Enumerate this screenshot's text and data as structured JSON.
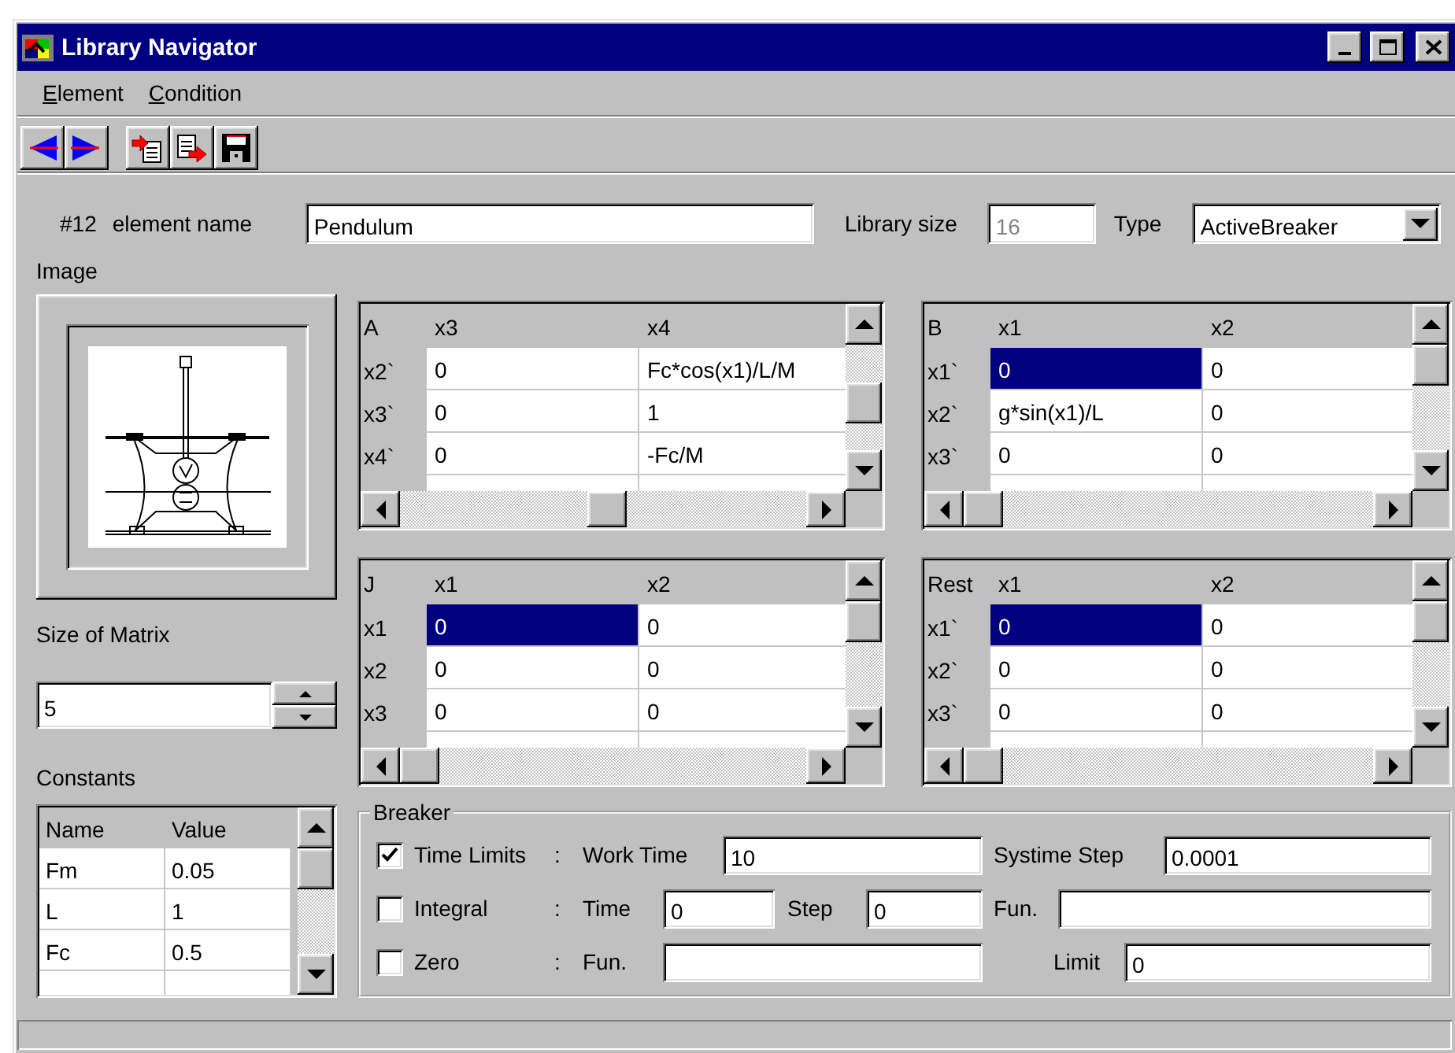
{
  "window": {
    "title": "Library Navigator"
  },
  "menu": [
    {
      "label": "Element"
    },
    {
      "label": "Condition"
    }
  ],
  "element": {
    "number": "#12",
    "label": "element name",
    "value": "Pendulum"
  },
  "library_size": {
    "label": "Library size",
    "value": "16",
    "disabled": true
  },
  "type": {
    "label": "Type",
    "value": "ActiveBreaker"
  },
  "image": {
    "label": "Image"
  },
  "size_of_matrix": {
    "label": "Size of Matrix",
    "value": "5"
  },
  "constants": {
    "label": "Constants",
    "columns": [
      "Name",
      "Value"
    ],
    "rows": [
      [
        "Fm",
        "0.05"
      ],
      [
        "L",
        "1"
      ],
      [
        "Fc",
        "0.5"
      ]
    ]
  },
  "matrices": [
    {
      "corner": "A",
      "columns": [
        "x3",
        "x4"
      ],
      "rows": [
        {
          "label": "x2`",
          "cells": [
            {
              "text": "0",
              "selected": false
            },
            {
              "text": "Fc*cos(x1)/L/M",
              "selected": false
            }
          ]
        },
        {
          "label": "x3`",
          "cells": [
            {
              "text": "0",
              "selected": false
            },
            {
              "text": "1",
              "selected": false
            }
          ]
        },
        {
          "label": "x4`",
          "cells": [
            {
              "text": "0",
              "selected": false
            },
            {
              "text": "-Fc/M",
              "selected": false
            }
          ]
        }
      ]
    },
    {
      "corner": "B",
      "columns": [
        "x1",
        "x2"
      ],
      "rows": [
        {
          "label": "x1`",
          "cells": [
            {
              "text": "0",
              "selected": true
            },
            {
              "text": "0",
              "selected": false
            }
          ]
        },
        {
          "label": "x2`",
          "cells": [
            {
              "text": "g*sin(x1)/L",
              "selected": false
            },
            {
              "text": "0",
              "selected": false
            }
          ]
        },
        {
          "label": "x3`",
          "cells": [
            {
              "text": "0",
              "selected": false
            },
            {
              "text": "0",
              "selected": false
            }
          ]
        }
      ]
    },
    {
      "corner": "J",
      "columns": [
        "x1",
        "x2"
      ],
      "rows": [
        {
          "label": "x1",
          "cells": [
            {
              "text": "0",
              "selected": true
            },
            {
              "text": "0",
              "selected": false
            }
          ]
        },
        {
          "label": "x2",
          "cells": [
            {
              "text": "0",
              "selected": false
            },
            {
              "text": "0",
              "selected": false
            }
          ]
        },
        {
          "label": "x3",
          "cells": [
            {
              "text": "0",
              "selected": false
            },
            {
              "text": "0",
              "selected": false
            }
          ]
        }
      ]
    },
    {
      "corner": "Rest",
      "columns": [
        "x1",
        "x2"
      ],
      "rows": [
        {
          "label": "x1`",
          "cells": [
            {
              "text": "0",
              "selected": true
            },
            {
              "text": "0",
              "selected": false
            }
          ]
        },
        {
          "label": "x2`",
          "cells": [
            {
              "text": "0",
              "selected": false
            },
            {
              "text": "0",
              "selected": false
            }
          ]
        },
        {
          "label": "x3`",
          "cells": [
            {
              "text": "0",
              "selected": false
            },
            {
              "text": "0",
              "selected": false
            }
          ]
        }
      ]
    }
  ],
  "breaker": {
    "title": "Breaker",
    "rows": [
      {
        "label": "Time Limits",
        "checked": true,
        "separator": ":",
        "fields": [
          {
            "label": "Work Time",
            "value": "10"
          },
          {
            "label": "Systime Step",
            "value": "0.0001"
          }
        ]
      },
      {
        "label": "Integral",
        "checked": false,
        "separator": ":",
        "fields": [
          {
            "label": "Time",
            "value": "0"
          },
          {
            "label": "Step",
            "value": "0"
          },
          {
            "label": "Fun."
          }
        ]
      },
      {
        "label": "Zero",
        "checked": false,
        "separator": ":",
        "fields": [
          {
            "label": "Fun."
          },
          {
            "label": "Limit",
            "value": "0"
          }
        ]
      }
    ]
  }
}
